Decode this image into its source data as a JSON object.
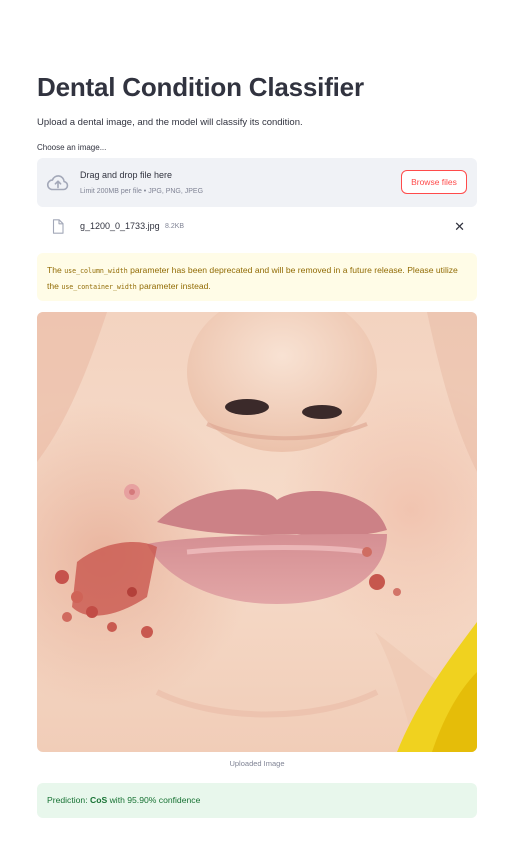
{
  "header": {
    "title": "Dental Condition Classifier",
    "subtitle": "Upload a dental image, and the model will classify its condition."
  },
  "uploader": {
    "label": "Choose an image...",
    "drop_text": "Drag and drop file here",
    "limit_text": "Limit 200MB per file • JPG, PNG, JPEG",
    "browse_label": "Browse files",
    "file": {
      "name": "g_1200_0_1733.jpg",
      "size": "8.2KB",
      "remove_symbol": "✕"
    }
  },
  "warning": {
    "prefix": "The ",
    "param_old": "use_column_width",
    "middle": " parameter has been deprecated and will be removed in a future release. Please utilize the ",
    "param_new": "use_container_width",
    "suffix": " parameter instead."
  },
  "image": {
    "caption": "Uploaded Image"
  },
  "result": {
    "prefix": "Prediction: ",
    "label": "CoS",
    "suffix": " with 95.90% confidence"
  },
  "colors": {
    "primary": "#ff4b4b",
    "warning_bg": "#fffce7",
    "warning_text": "#926c05",
    "success_bg": "#e8f7ec",
    "success_text": "#177233"
  },
  "icons": {
    "upload": "cloud-upload-icon",
    "file": "file-icon",
    "close": "close-icon"
  }
}
